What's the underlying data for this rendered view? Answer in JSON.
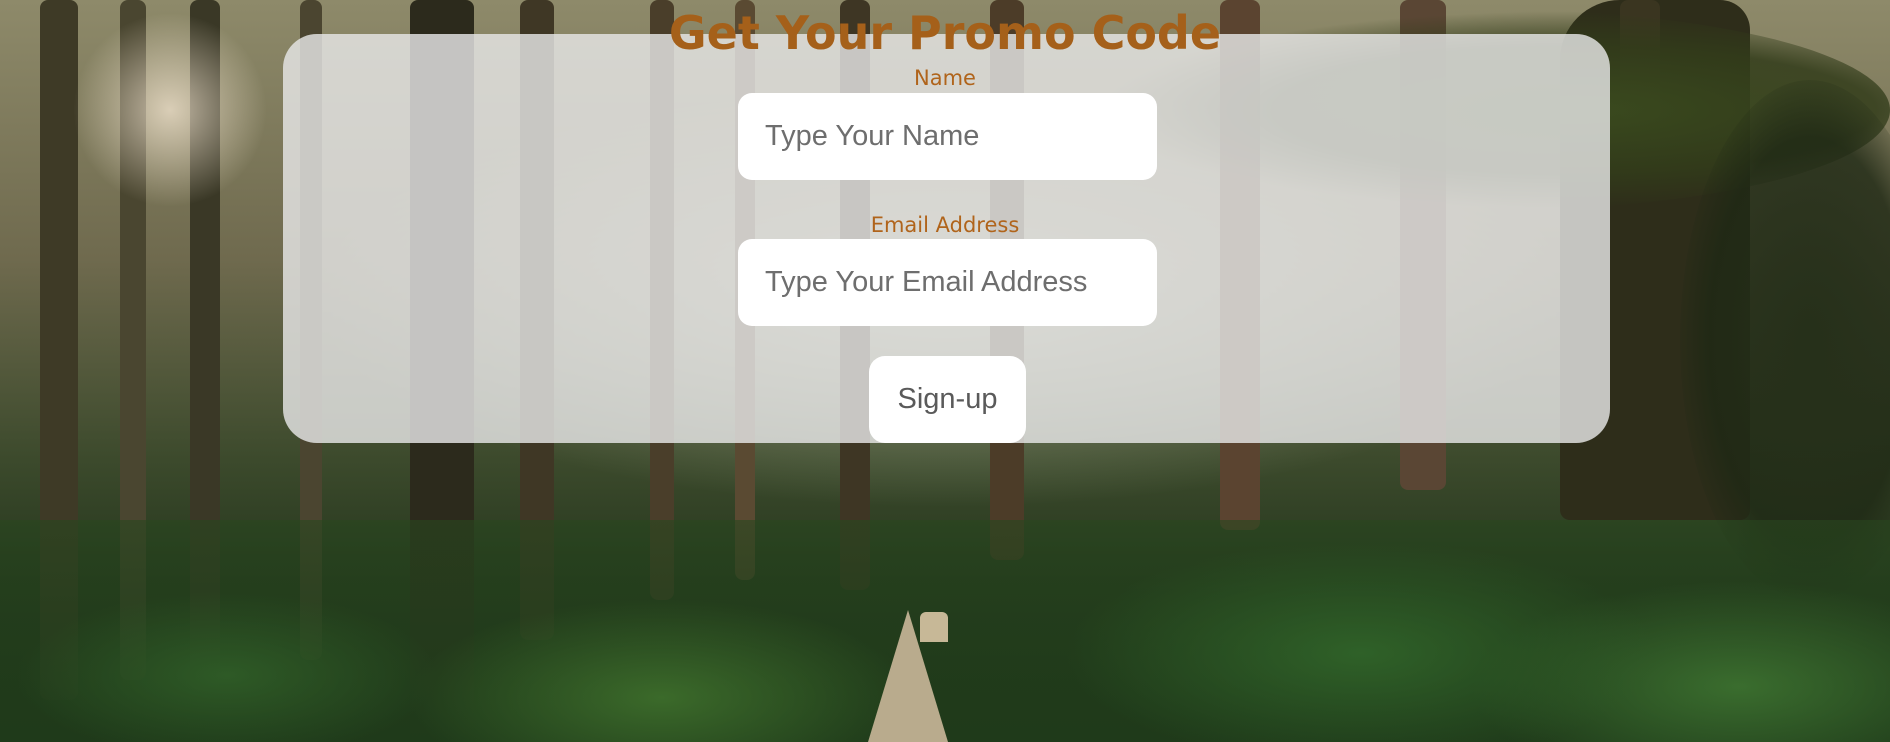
{
  "form": {
    "title": "Get Your Promo Code",
    "name_label": "Name",
    "name_placeholder": "Type Your Name",
    "email_label": "Email Address",
    "email_placeholder": "Type Your Email Address",
    "submit_label": "Sign-up"
  },
  "colors": {
    "accent": "#a5601a",
    "card_bg": "#e6e6e6",
    "input_bg": "#ffffff"
  }
}
